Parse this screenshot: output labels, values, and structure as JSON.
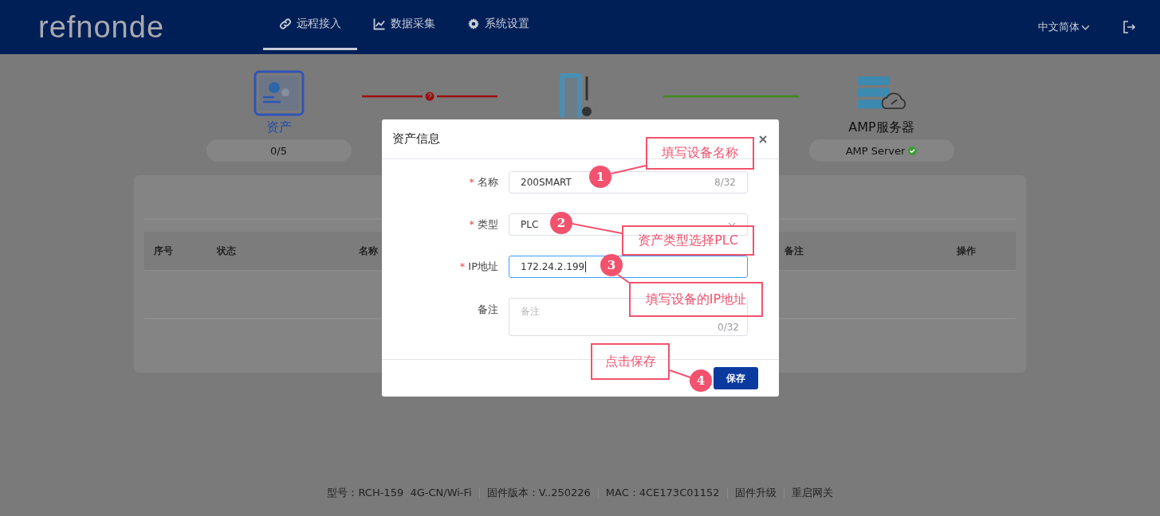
{
  "header": {
    "logo": "refnonde",
    "language": "中文简体"
  },
  "nav": [
    {
      "label": "远程接入",
      "selected": true
    },
    {
      "label": "数据采集",
      "selected": false
    },
    {
      "label": "系统设置",
      "selected": false
    }
  ],
  "topology": {
    "nodes": [
      {
        "kind": "asset",
        "label": "资产",
        "color": "#2450a8",
        "badge": "0/5"
      },
      {
        "kind": "gateway"
      },
      {
        "kind": "server",
        "label": "AMP服务器",
        "color": "#111111",
        "badge": "AMP Server",
        "ok": true
      }
    ],
    "links": [
      {
        "kind": "error",
        "color": "#a00d0d"
      },
      {
        "kind": "ok",
        "color": "#3f8a16"
      }
    ]
  },
  "table": {
    "columns": [
      "序号",
      "状态",
      "名称",
      "备注",
      "操作"
    ]
  },
  "dialog": {
    "title": "资产信息",
    "fields": [
      {
        "kind": "input",
        "mark": "*",
        "label": "名称",
        "value": "200SMART",
        "counter": "8/32",
        "focused": false
      },
      {
        "kind": "select",
        "mark": "*",
        "label": "类型",
        "value": "PLC",
        "focused": false
      },
      {
        "kind": "input",
        "mark": "*",
        "label": "IP地址",
        "value": "172.24.2.199",
        "focused": true
      },
      {
        "kind": "textarea",
        "label": "备注",
        "placeholder": "备注",
        "counter": "0/32",
        "focused": false
      }
    ],
    "save": "保存"
  },
  "annotations": [
    {
      "number": "1",
      "text": "填写设备名称"
    },
    {
      "number": "2",
      "text": "资产类型选择PLC"
    },
    {
      "number": "3",
      "text": "填写设备的IP地址"
    },
    {
      "number": "4",
      "text": "点击保存"
    }
  ],
  "footer": {
    "info": [
      "型号：RCH-159  4G-CN/Wi-Fi",
      "固件版本：V..250226",
      "MAC：4CE173C01152"
    ],
    "actions": [
      "固件升级",
      "重启网关"
    ]
  }
}
